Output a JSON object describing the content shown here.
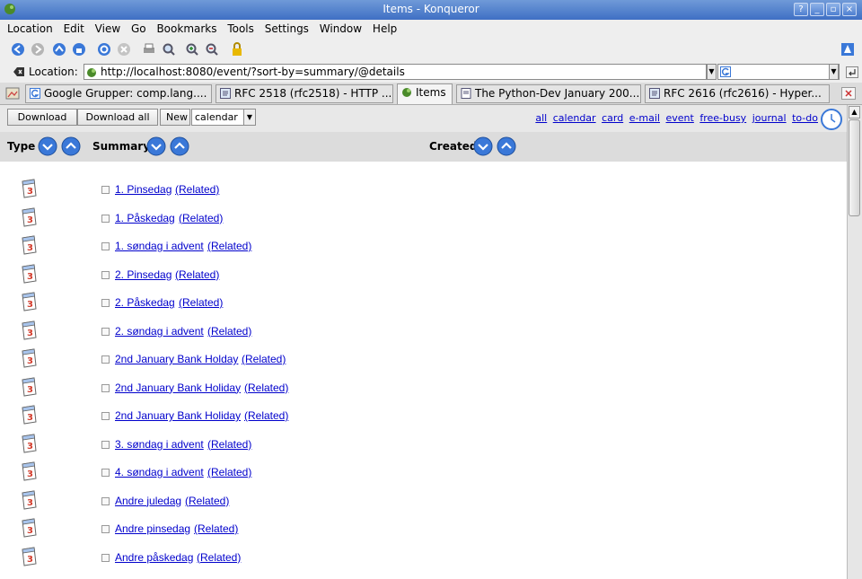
{
  "window": {
    "title": "Items - Konqueror",
    "buttons": [
      "?",
      "_",
      "▫",
      "×"
    ]
  },
  "menu": [
    "Location",
    "Edit",
    "View",
    "Go",
    "Bookmarks",
    "Tools",
    "Settings",
    "Window",
    "Help"
  ],
  "location": {
    "label": "Location:",
    "url": "http://localhost:8080/event/?sort-by=summary/@details",
    "search_value": ""
  },
  "tabs": [
    {
      "label": "Google Grupper: comp.lang...."
    },
    {
      "label": "RFC 2518 (rfc2518) - HTTP ..."
    },
    {
      "label": "Items"
    },
    {
      "label": "The Python-Dev January 200..."
    },
    {
      "label": "RFC 2616 (rfc2616) - Hyper..."
    }
  ],
  "actions": {
    "download": "Download",
    "download_all": "Download all",
    "new": "New",
    "calendar_select": "calendar"
  },
  "filters": [
    "all",
    "calendar",
    "card",
    "e-mail",
    "event",
    "free-busy",
    "journal",
    "to-do"
  ],
  "columns": {
    "type": "Type",
    "summary": "Summary",
    "created": "Created"
  },
  "related_label": "(Related)",
  "items": [
    "1. Pinsedag",
    "1. Påskedag",
    "1. søndag i advent",
    "2. Pinsedag",
    "2. Påskedag",
    "2. søndag i advent",
    "2nd January Bank Holday",
    "2nd January Bank Holiday",
    "2nd January Bank Holiday",
    "3. søndag i advent",
    "4. søndag i advent",
    "Andre juledag",
    "Andre pinsedag",
    "Andre påskedag"
  ],
  "icon_colors": {
    "calendar_red": "#d23a2a",
    "sort_blue": "#3a78d8",
    "link": "#0000cc"
  }
}
